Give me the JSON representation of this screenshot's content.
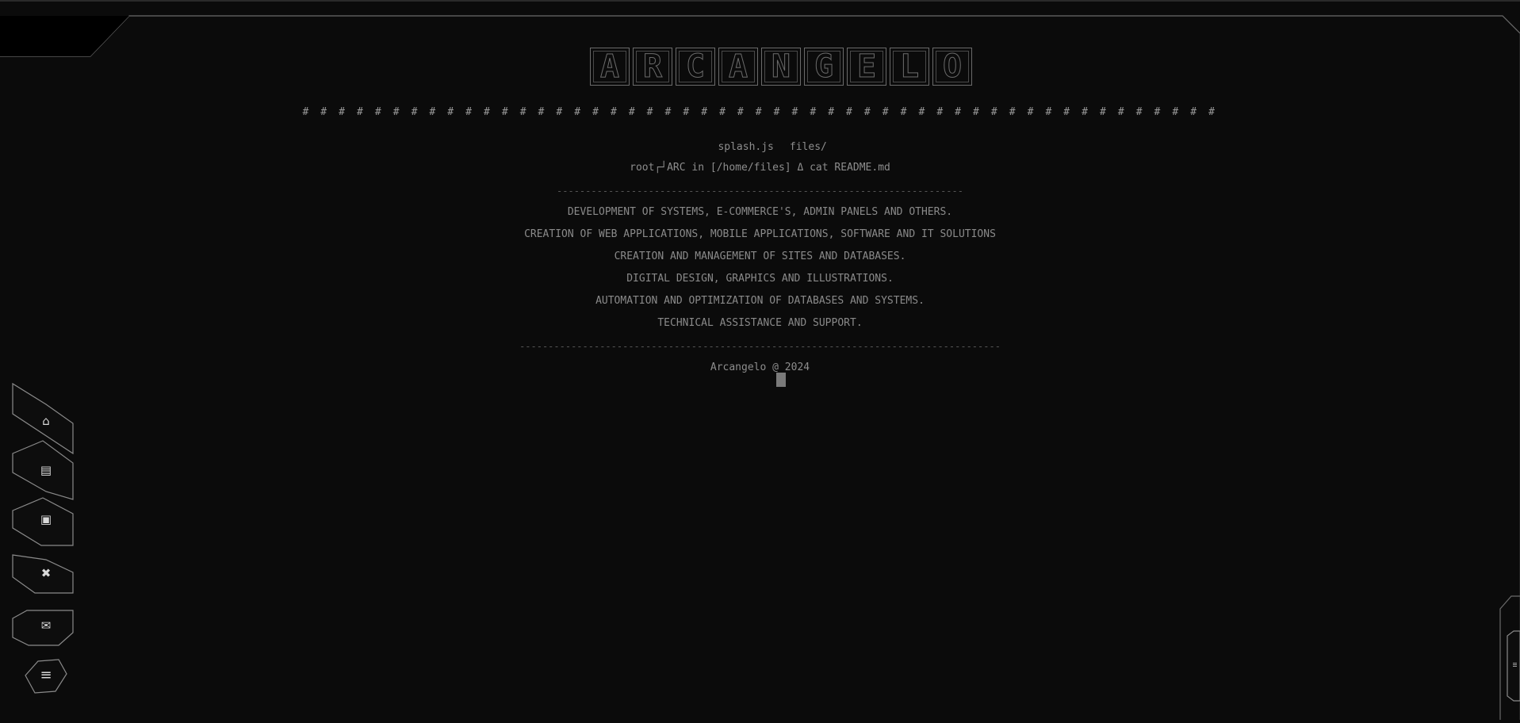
{
  "title": "ARCANGELO",
  "title_letters": [
    "A",
    "R",
    "C",
    "A",
    "N",
    "G",
    "E",
    "L",
    "O"
  ],
  "hashes": "# # # # # # # # # # # # # # # # # # # # # # # # # # # # # # # # # # # # # # # # # # # # # # # # # # #",
  "ls": {
    "file1": "splash.js",
    "file2": "files/"
  },
  "prompt": "root┌┘ARC in [/home/files] Δ cat README.md",
  "divider1": "-----------------------------------------------------------------------",
  "services": [
    "DEVELOPMENT OF SYSTEMS, E-COMMERCE'S, ADMIN PANELS AND OTHERS.",
    "CREATION OF WEB APPLICATIONS, MOBILE APPLICATIONS, SOFTWARE AND IT SOLUTIONS",
    "CREATION AND MANAGEMENT OF SITES AND DATABASES.",
    "DIGITAL DESIGN, GRAPHICS AND ILLUSTRATIONS.",
    "AUTOMATION AND OPTIMIZATION OF DATABASES AND SYSTEMS.",
    "TECHNICAL ASSISTANCE AND SUPPORT."
  ],
  "divider2": "------------------------------------------------------------------------------------",
  "copyright": "Arcangelo @ 2024",
  "nav": [
    {
      "icon": "home-icon",
      "glyph": "⌂"
    },
    {
      "icon": "id-card-icon",
      "glyph": "▤"
    },
    {
      "icon": "gallery-icon",
      "glyph": "▣"
    },
    {
      "icon": "tools-icon",
      "glyph": "✖"
    },
    {
      "icon": "mail-icon",
      "glyph": "✉"
    },
    {
      "icon": "menu-icon",
      "glyph": "≡"
    }
  ],
  "colors": {
    "background": "#0b0b0b",
    "text": "#8d8d8d",
    "frame": "#5a5a5a",
    "icon": "#d8d8d8"
  }
}
